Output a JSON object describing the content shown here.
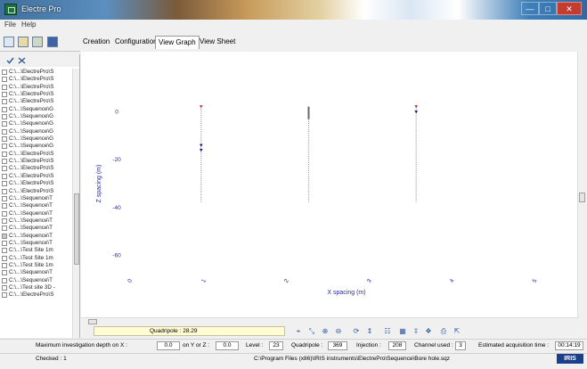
{
  "window": {
    "title": "Electre Pro",
    "controls": [
      "—",
      "□",
      "✕"
    ]
  },
  "menu": [
    "File",
    "Help"
  ],
  "tabs": [
    "Creation",
    "Configuration",
    "View Graph",
    "View Sheet"
  ],
  "active_tab": "View Graph",
  "sidebar": {
    "items": [
      {
        "label": "C:\\...\\ElectrePro\\S",
        "checked": false
      },
      {
        "label": "C:\\...\\ElectrePro\\S",
        "checked": false
      },
      {
        "label": "C:\\...\\ElectrePro\\S",
        "checked": false
      },
      {
        "label": "C:\\...\\ElectrePro\\S",
        "checked": false
      },
      {
        "label": "C:\\...\\ElectrePro\\S",
        "checked": false
      },
      {
        "label": "C:\\...\\Sequence\\G",
        "checked": false
      },
      {
        "label": "C:\\...\\Sequence\\G",
        "checked": false
      },
      {
        "label": "C:\\...\\Sequence\\G",
        "checked": false
      },
      {
        "label": "C:\\...\\Sequence\\G",
        "checked": false
      },
      {
        "label": "C:\\...\\Sequence\\G",
        "checked": false
      },
      {
        "label": "C:\\...\\Sequence\\G",
        "checked": false
      },
      {
        "label": "C:\\...\\ElectrePro\\S",
        "checked": false
      },
      {
        "label": "C:\\...\\ElectrePro\\S",
        "checked": false
      },
      {
        "label": "C:\\...\\ElectrePro\\S",
        "checked": false
      },
      {
        "label": "C:\\...\\ElectrePro\\S",
        "checked": false
      },
      {
        "label": "C:\\...\\ElectrePro\\S",
        "checked": false
      },
      {
        "label": "C:\\...\\ElectrePro\\S",
        "checked": false
      },
      {
        "label": "C:\\...\\Sequence\\T",
        "checked": false
      },
      {
        "label": "C:\\...\\Sequence\\T",
        "checked": false
      },
      {
        "label": "C:\\...\\Sequence\\T",
        "checked": false
      },
      {
        "label": "C:\\...\\Sequence\\T",
        "checked": false
      },
      {
        "label": "C:\\...\\Sequence\\T",
        "checked": false
      },
      {
        "label": "C:\\...\\Sequence\\T",
        "checked": true
      },
      {
        "label": "C:\\...\\Sequence\\T",
        "checked": false
      },
      {
        "label": "C:\\...\\Test Site 1m",
        "checked": false
      },
      {
        "label": "C:\\...\\Test Site 1m",
        "checked": false
      },
      {
        "label": "C:\\...\\Test Site 1m",
        "checked": false
      },
      {
        "label": "C:\\...\\Sequence\\T",
        "checked": false
      },
      {
        "label": "C:\\...\\Sequence\\T",
        "checked": false
      },
      {
        "label": "C:\\...\\Test site 3D -",
        "checked": false
      },
      {
        "label": "C:\\...\\ElectrePro\\S",
        "checked": false
      }
    ]
  },
  "chart_data": {
    "type": "scatter",
    "xlabel": "X spacing (m)",
    "ylabel": "Z spacing (m)",
    "x_ticks": [
      "0",
      "1",
      "2",
      "3",
      "4",
      "5"
    ],
    "y_ticks": [
      "0",
      "-20",
      "-40",
      "-60"
    ],
    "ylim": [
      -68,
      14
    ],
    "xlim": [
      -0.2,
      5.4
    ],
    "boreholes": [
      {
        "x": 0.95,
        "z_top": 2.2,
        "z_bottom": -38,
        "top_markers": [
          {
            "z": 2.2,
            "color": "#c0392b"
          },
          {
            "z": -14,
            "color": "#1a1a8a"
          },
          {
            "z": -16,
            "color": "#1a1a8a"
          }
        ]
      },
      {
        "x": 2.25,
        "z_top": 2.2,
        "z_bottom": -38,
        "top_markers": [
          {
            "z": 2.2,
            "color": "#7a7a7a"
          }
        ]
      },
      {
        "x": 3.55,
        "z_top": 2.2,
        "z_bottom": -38,
        "top_markers": [
          {
            "z": 2.2,
            "color": "#c0392b"
          },
          {
            "z": 0,
            "color": "#1a1a8a"
          }
        ]
      }
    ]
  },
  "quadripole_field": "Quadripole : 28.29",
  "status": {
    "max_depth_label": "Maximum investigation depth on X :",
    "max_depth_x": "0.0",
    "on_y_label": "on Y or Z :",
    "max_depth_z": "0.0",
    "level_label": "Level :",
    "level": "23",
    "quadripole_label": "Quadripole :",
    "quadripole": "369",
    "injection_label": "Injection :",
    "injection": "208",
    "channel_label": "Channel used :",
    "channel": "3",
    "time_label": "Estimated acquisition time :",
    "time": "00:14:19"
  },
  "footer": {
    "checked": "Checked : 1",
    "path": "C:\\Program Files (x86)\\IRIS instruments\\ElectrePro\\Sequence\\Bore hole.sqz",
    "logo": "IRIS"
  }
}
